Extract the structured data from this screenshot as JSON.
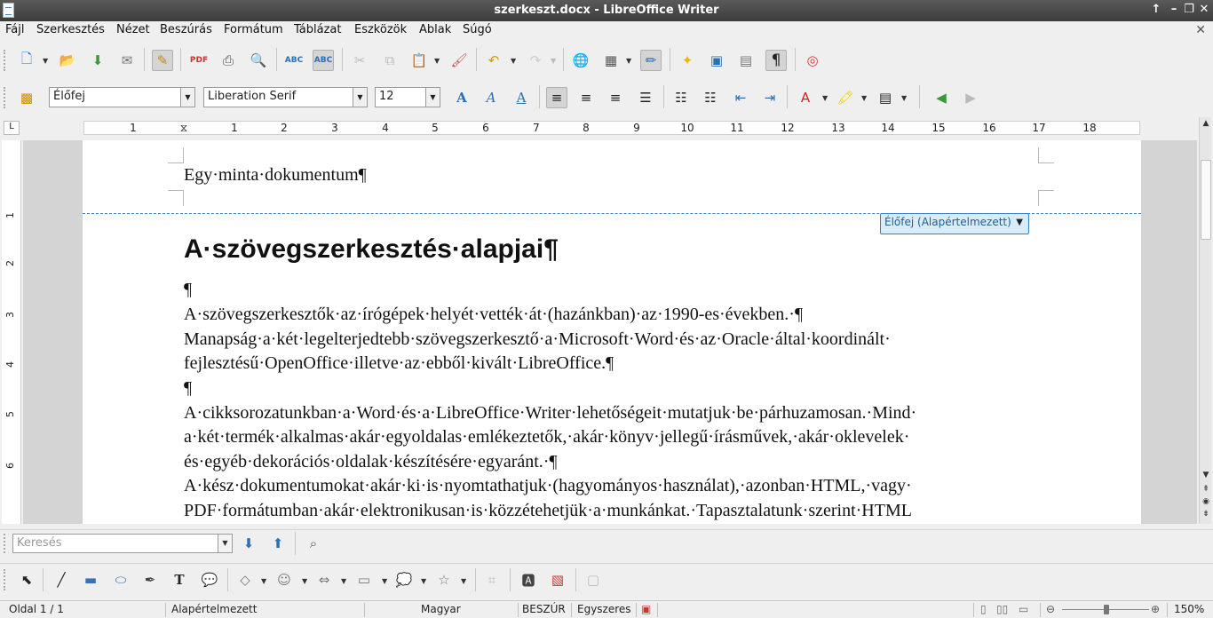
{
  "window": {
    "title": "szerkeszt.docx - LibreOffice Writer"
  },
  "menu": [
    "Fájl",
    "Szerkesztés",
    "Nézet",
    "Beszúrás",
    "Formátum",
    "Táblázat",
    "Eszközök",
    "Ablak",
    "Súgó"
  ],
  "formatting": {
    "paragraph_style": "Élőfej",
    "font_name": "Liberation Serif",
    "font_size": "12"
  },
  "ruler": {
    "h_ticks": [
      "1",
      "1",
      "2",
      "3",
      "4",
      "5",
      "6",
      "7",
      "8",
      "9",
      "10",
      "11",
      "12",
      "13",
      "14",
      "15",
      "16",
      "17",
      "18"
    ],
    "v_ticks": [
      "1",
      "2",
      "3",
      "4",
      "5",
      "6"
    ]
  },
  "document": {
    "header_text": "Egy·minta·dokumentum¶",
    "header_tag": "Élőfej (Alapértelmezett)",
    "heading": "A·szövegszerkesztés·alapjai¶",
    "lines": [
      "¶",
      "A·szövegszerkesztők·az·írógépek·helyét·vették·át·(hazánkban)·az·1990-es·években.·¶",
      "Manapság·a·két·legelterjedtebb·szövegszerkesztő·a·Microsoft·Word·és·az·Oracle·által·koordinált·",
      "fejlesztésű·OpenOffice·illetve·az·ebből·kivált·LibreOffice.¶",
      "¶",
      "A·cikksorozatunkban·a·Word·és·a·LibreOffice·Writer·lehetőségeit·mutatjuk·be·párhuzamosan.·Mind·",
      "a·két·termék·alkalmas·akár·egyoldalas·emlékeztetők,·akár·könyv·jellegű·írásművek,·akár·oklevelek·",
      "és·egyéb·dekorációs·oldalak·készítésére·egyaránt.·¶",
      "A·kész·dokumentumokat·akár·ki·is·nyomtathatjuk·(hagyományos·használat),·azonban·HTML,·vagy·",
      "PDF·formátumban·akár·elektronikusan·is·közzétehetjük·a·munkánkat.·Tapasztalatunk·szerint·HTML"
    ]
  },
  "find": {
    "placeholder": "Keresés"
  },
  "status": {
    "page": "Oldal 1 / 1",
    "page_style": "Alapértelmezett",
    "language": "Magyar",
    "insert_mode": "BESZÚR",
    "selection_mode": "Egyszeres",
    "zoom": "150%"
  }
}
